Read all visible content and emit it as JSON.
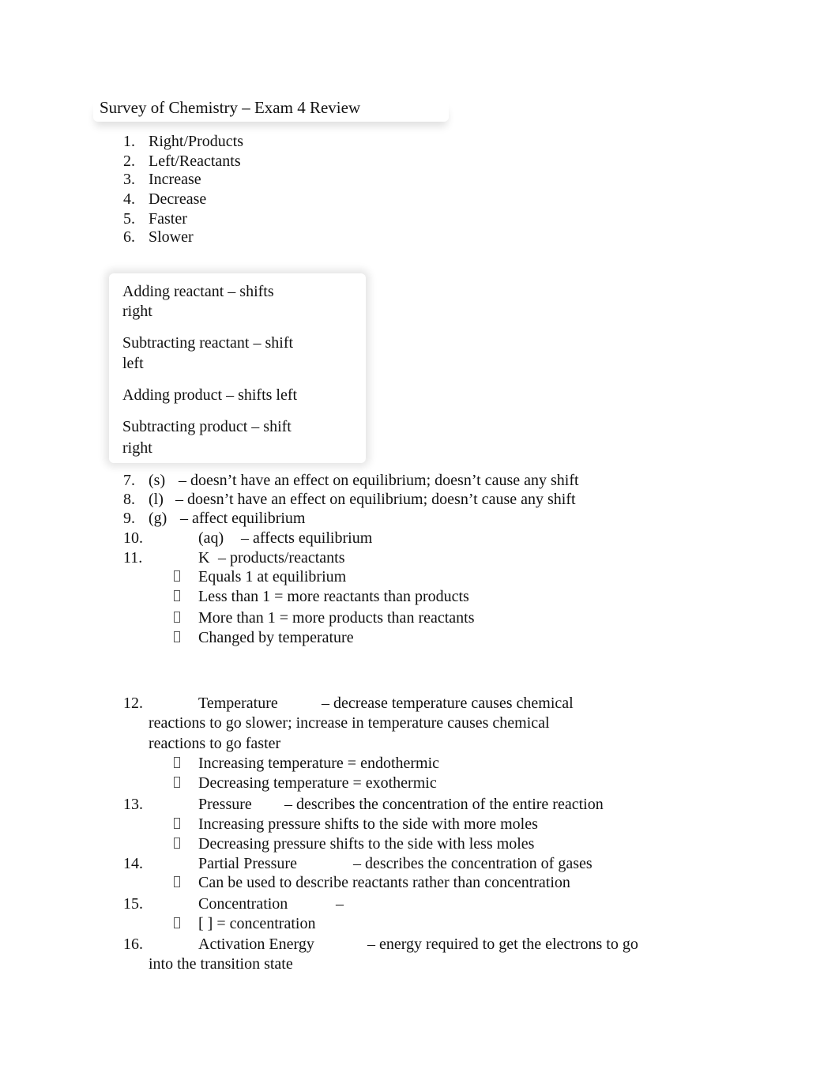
{
  "title": "Survey of Chemistry – Exam 4 Review",
  "list_top": [
    {
      "num": "1.",
      "text": "Right/Products"
    },
    {
      "num": "2.",
      "text": "Left/Reactants"
    },
    {
      "num": "3.",
      "text": "Increase"
    },
    {
      "num": "4.",
      "text": "Decrease"
    },
    {
      "num": "5.",
      "text": "Faster"
    },
    {
      "num": "6.",
      "text": "Slower"
    }
  ],
  "box": {
    "lines": [
      "Adding reactant – shifts",
      "right",
      "Subtracting reactant – shift",
      "left",
      "Adding product – shifts left",
      "Subtracting product – shift",
      "right"
    ]
  },
  "items": {
    "i7": {
      "num": "7.",
      "term": "(s)",
      "desc": "– doesn’t have an effect on equilibrium; doesn’t cause any shift"
    },
    "i8": {
      "num": "8.",
      "term": "(l)",
      "desc": "– doesn’t have an effect on equilibrium; doesn’t cause any shift"
    },
    "i9": {
      "num": "9.",
      "term": "(g)",
      "desc": "– affect equilibrium"
    },
    "i10": {
      "num": "10.",
      "term": "(aq)",
      "desc": "– affects equilibrium"
    },
    "i11": {
      "num": "11.",
      "term": "K",
      "desc": "– products/reactants",
      "bullets": [
        "Equals 1 at equilibrium",
        "Less than 1 = more reactants than products",
        "More than 1 = more products than reactants",
        "Changed by temperature"
      ]
    },
    "i12": {
      "num": "12.",
      "term": "Temperature",
      "desc": "– decrease temperature causes chemical",
      "cont": [
        "reactions to go slower; increase in temperature causes chemical",
        "reactions to go faster"
      ],
      "bullets": [
        "Increasing temperature = endothermic",
        "Decreasing temperature = exothermic"
      ]
    },
    "i13": {
      "num": "13.",
      "term": "Pressure",
      "desc": "– describes the concentration of the entire reaction",
      "bullets": [
        "Increasing pressure shifts to the side with more moles",
        "Decreasing pressure shifts to the side with less moles"
      ]
    },
    "i14": {
      "num": "14.",
      "term": "Partial Pressure",
      "desc": "– describes the concentration of gases",
      "bullets": [
        "Can be used to describe reactants rather than concentration"
      ]
    },
    "i15": {
      "num": "15.",
      "term": "Concentration",
      "desc": "–",
      "bullets": [
        "[ ] = concentration"
      ]
    },
    "i16": {
      "num": "16.",
      "term": "Activation Energy",
      "desc": "– energy required to get the electrons to go",
      "cont": [
        "into the transition state"
      ]
    }
  }
}
